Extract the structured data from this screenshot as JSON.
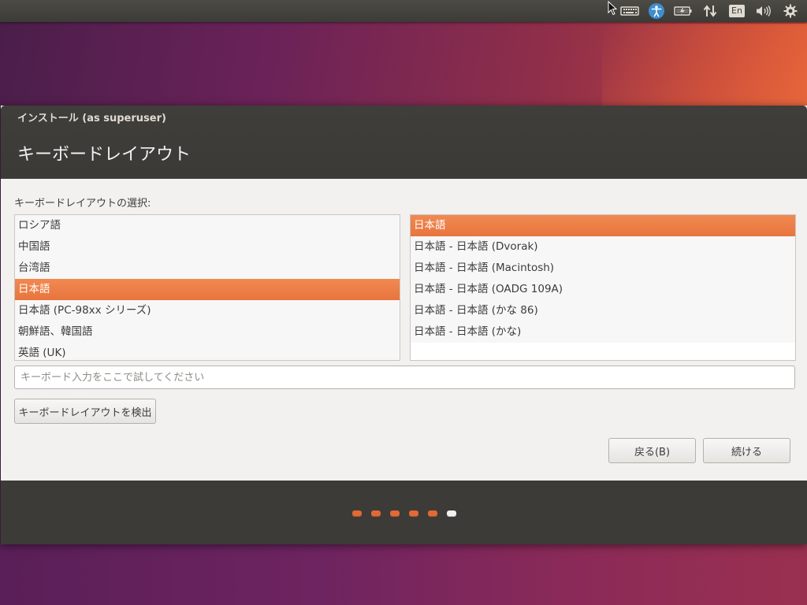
{
  "top_panel": {
    "indicators": [
      {
        "icon": "keyboard-icon"
      },
      {
        "icon": "accessibility-icon"
      },
      {
        "icon": "battery-icon"
      },
      {
        "icon": "network-icon"
      },
      {
        "icon": "language-icon",
        "label": "En"
      },
      {
        "icon": "volume-icon"
      },
      {
        "icon": "system-gear-icon"
      }
    ]
  },
  "window": {
    "title": "インストール (as superuser)",
    "page_title": "キーボードレイアウト",
    "select_label": "キーボードレイアウトの選択:",
    "layouts": [
      {
        "label": "ロシア語",
        "selected": false
      },
      {
        "label": "中国語",
        "selected": false
      },
      {
        "label": "台湾語",
        "selected": false
      },
      {
        "label": "日本語",
        "selected": true
      },
      {
        "label": "日本語 (PC-98xx シリーズ)",
        "selected": false
      },
      {
        "label": "朝鮮語、韓国語",
        "selected": false
      },
      {
        "label": "英語 (UK)",
        "selected": false
      }
    ],
    "variants": [
      {
        "label": "日本語",
        "selected": true
      },
      {
        "label": "日本語 - 日本語 (Dvorak)",
        "selected": false
      },
      {
        "label": "日本語 - 日本語 (Macintosh)",
        "selected": false
      },
      {
        "label": "日本語 - 日本語 (OADG 109A)",
        "selected": false
      },
      {
        "label": "日本語 - 日本語 (かな 86)",
        "selected": false
      },
      {
        "label": "日本語 - 日本語 (かな)",
        "selected": false
      }
    ],
    "test_placeholder": "キーボード入力をここで試してください",
    "detect_button": "キーボードレイアウトを検出",
    "back_button": "戻る(B)",
    "continue_button": "続ける"
  },
  "progress": {
    "total_steps": 6,
    "current_step": 6
  },
  "colors": {
    "accent": "#e8743e",
    "panel": "#3c3b37",
    "window_bg": "#f2f1f0"
  }
}
